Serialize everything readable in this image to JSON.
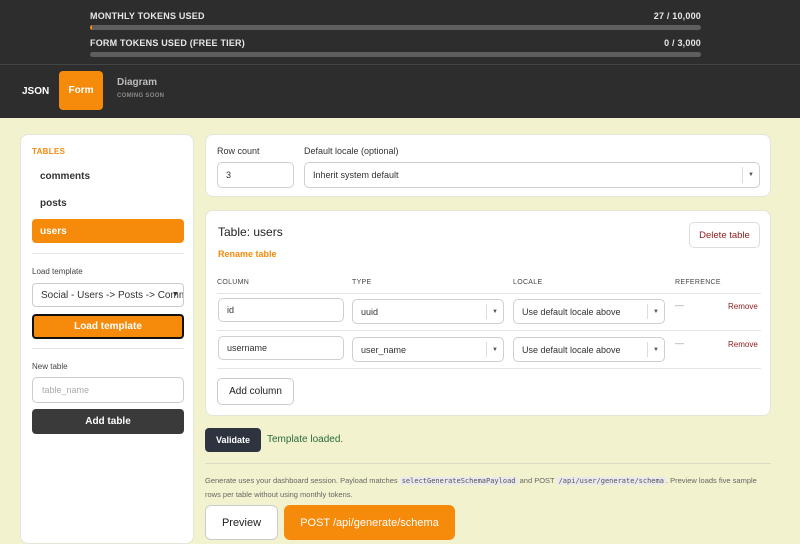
{
  "usage": {
    "monthly_label": "MONTHLY TOKENS USED",
    "monthly_value": "27 / 10,000",
    "monthly_fraction": 0.0027,
    "form_label": "FORM TOKENS USED (FREE TIER)",
    "form_value": "0 / 3,000",
    "form_fraction": 0
  },
  "tabs": {
    "json": "JSON",
    "form": "Form",
    "diagram": "Diagram",
    "diagram_note": "COMING SOON"
  },
  "sidebar": {
    "title": "TABLES",
    "tables": [
      "comments",
      "posts",
      "users"
    ],
    "active_table": "users",
    "load_template_label": "Load template",
    "template_selected": "Social - Users -> Posts -> Comments",
    "load_template_button": "Load template",
    "new_table_label": "New table",
    "new_table_placeholder": "table_name",
    "add_table_button": "Add table"
  },
  "settings": {
    "row_count_label": "Row count",
    "row_count_value": "3",
    "locale_label": "Default locale (optional)",
    "locale_value": "Inherit system default"
  },
  "table_editor": {
    "title": "Table: users",
    "rename_link": "Rename table",
    "delete_button": "Delete table",
    "headers": {
      "column": "COLUMN",
      "type": "TYPE",
      "locale": "LOCALE",
      "reference": "REFERENCE"
    },
    "columns": [
      {
        "name": "id",
        "type": "uuid",
        "locale": "Use default locale above",
        "reference": "—",
        "remove": "Remove"
      },
      {
        "name": "username",
        "type": "user_name",
        "locale": "Use default locale above",
        "reference": "—",
        "remove": "Remove"
      }
    ],
    "add_column_button": "Add column"
  },
  "actions": {
    "validate_button": "Validate",
    "status_text": "Template loaded.",
    "note_part1": "Generate uses your dashboard session. Payload matches",
    "note_code1": "selectGenerateSchemaPayload",
    "note_part2": "and POST",
    "note_code2": "/api/user/generate/schema",
    "note_part3": ". Preview loads five sample rows per table without using monthly tokens.",
    "preview_button": "Preview",
    "post_button": "POST /api/generate/schema"
  },
  "colors": {
    "accent": "#f58a0b",
    "header_bg": "#2d2d2d",
    "page_bg": "#f3f2cf",
    "danger": "#8b1d1d",
    "success": "#2b6b3b"
  }
}
